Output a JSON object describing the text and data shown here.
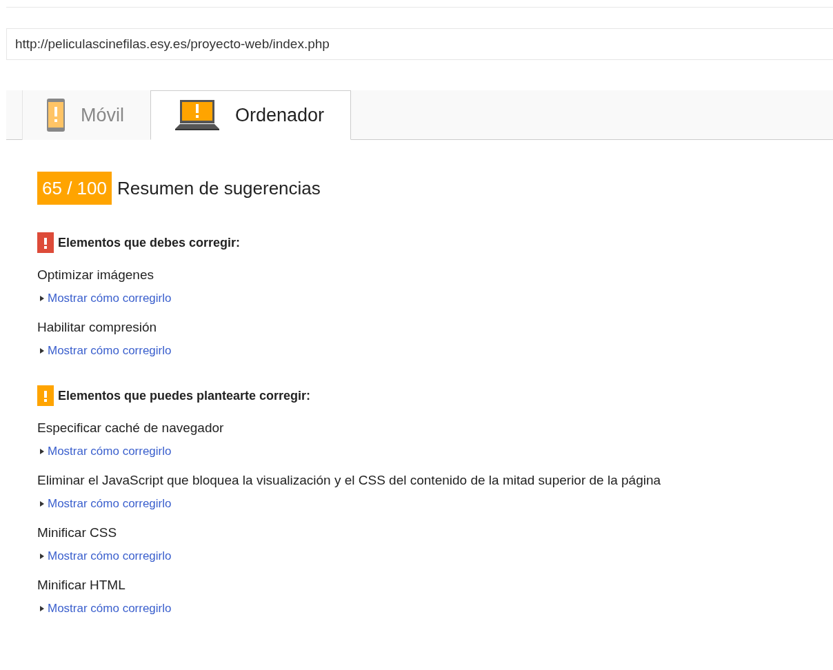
{
  "url_field": {
    "value": "http://peliculascinefilas.esy.es/proyecto-web/index.php"
  },
  "tabs": [
    {
      "label": "Móvil",
      "kind": "phone",
      "selected": false
    },
    {
      "label": "Ordenador",
      "kind": "laptop",
      "selected": true
    }
  ],
  "score": {
    "value": "65 / 100",
    "title": "Resumen de sugerencias"
  },
  "sections": [
    {
      "kind": "error",
      "heading": "Elementos que debes corregir:",
      "items": [
        {
          "title": "Optimizar imágenes",
          "link": "Mostrar cómo corregirlo",
          "expanded": false
        },
        {
          "title": "Habilitar compresión",
          "link": "Mostrar cómo corregirlo",
          "expanded": false
        }
      ]
    },
    {
      "kind": "warning",
      "heading": "Elementos que puedes plantearte corregir:",
      "items": [
        {
          "title": "Especificar caché de navegador",
          "link": "Mostrar cómo corregirlo",
          "expanded": false
        },
        {
          "title": "Eliminar el JavaScript que bloquea la visualización y el CSS del contenido de la mitad superior de la página",
          "link": "Mostrar cómo corregirlo",
          "expanded": false
        },
        {
          "title": "Minificar CSS",
          "link": "Mostrar cómo corregirlo",
          "expanded": false
        },
        {
          "title": "Minificar HTML",
          "link": "Mostrar cómo corregirlo",
          "expanded": false
        }
      ]
    }
  ]
}
